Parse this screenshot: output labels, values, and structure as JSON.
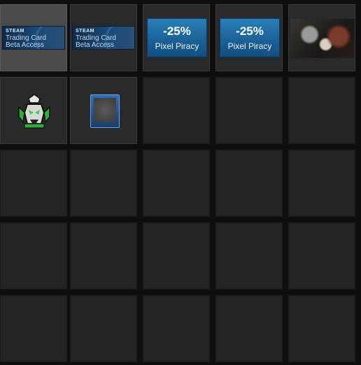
{
  "inventory": {
    "items": [
      {
        "type": "badge",
        "name": "trading-card-beta-badge",
        "brand": "STEAM",
        "line1": "Trading Card",
        "line2": "Beta Access"
      },
      {
        "type": "badge",
        "name": "trading-card-beta-badge",
        "brand": "STEAM",
        "line1": "Trading Card",
        "line2": "Beta Access"
      },
      {
        "type": "coupon",
        "name": "pixel-piracy-coupon",
        "discount": "-25%",
        "game": "Pixel Piracy"
      },
      {
        "type": "coupon",
        "name": "pixel-piracy-coupon",
        "discount": "-25%",
        "game": "Pixel Piracy"
      },
      {
        "type": "background",
        "name": "profile-background-artwork"
      },
      {
        "type": "emoticon",
        "name": "emoticon-figure"
      },
      {
        "type": "frame",
        "name": "profile-frame"
      }
    ],
    "columns": 5,
    "rows": 5,
    "selected_index": 0
  },
  "colors": {
    "empty_slot": "#232323",
    "filled_slot": "#2a2a2a",
    "selected_slot": "#4a4a4a",
    "coupon_blue": "#1a5f95"
  }
}
